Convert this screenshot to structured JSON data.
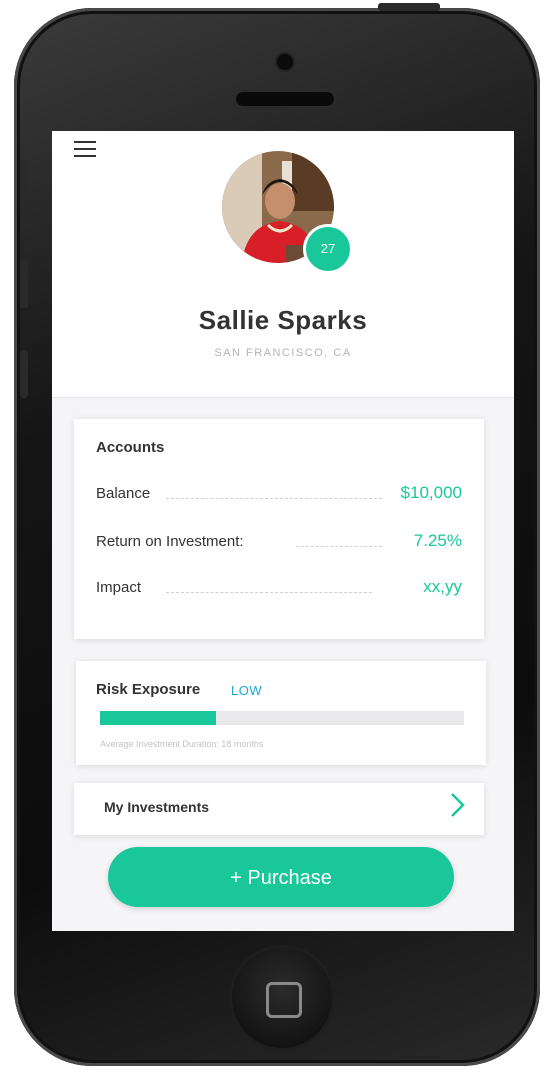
{
  "profile": {
    "name": "Sallie Sparks",
    "location": "SAN FRANCISCO, CA",
    "badge": "27"
  },
  "accounts": {
    "title": "Accounts",
    "rows": [
      {
        "label": "Balance",
        "value": "$10,000"
      },
      {
        "label": "Return on Investment:",
        "value": "7.25%"
      },
      {
        "label": "Impact",
        "value": "xx,yy"
      }
    ]
  },
  "risk": {
    "title": "Risk Exposure",
    "level": "LOW",
    "progress": 0.32,
    "caption": "Average Investment Duration: 18 months"
  },
  "investments": {
    "label": "My Investments"
  },
  "purchase": {
    "label": "+ Purchase"
  },
  "icons": {
    "menu": "hamburger-menu-icon",
    "chevron": "chevron-right-icon"
  },
  "colors": {
    "accent": "#19c79b",
    "risk_level": "#19a7d6"
  }
}
